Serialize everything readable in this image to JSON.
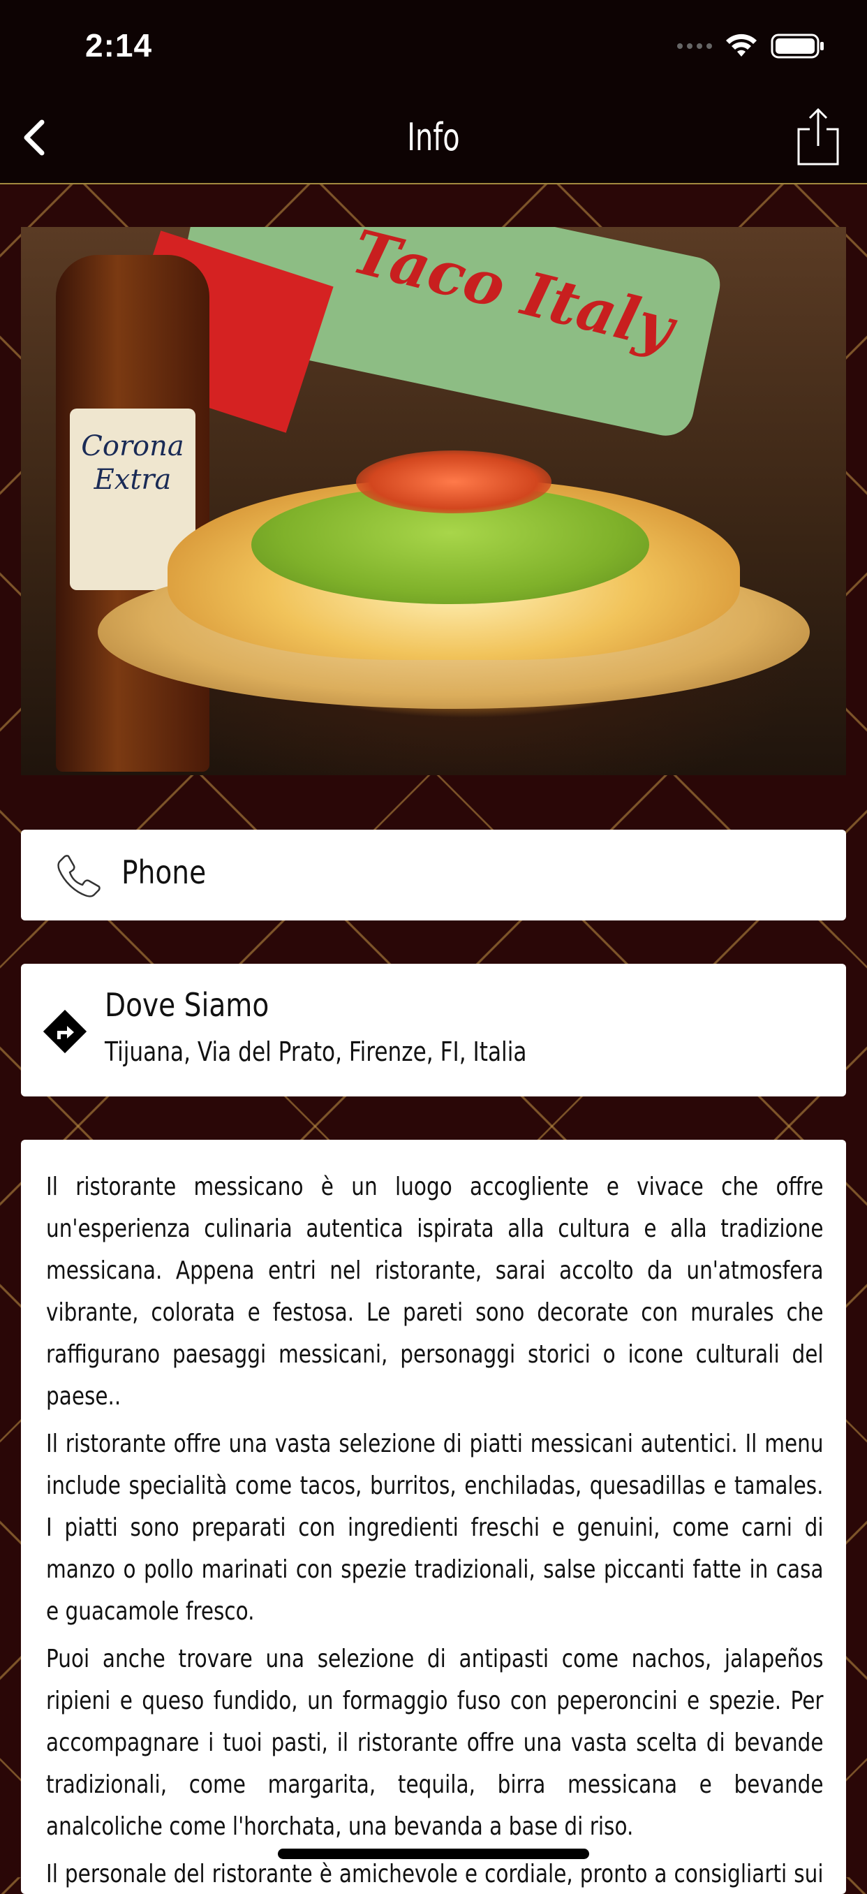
{
  "status_bar": {
    "time": "2:14"
  },
  "nav": {
    "title": "Info"
  },
  "hero": {
    "sign_text": "Taco Italy",
    "bottle_label": "Corona Extra"
  },
  "phone_card": {
    "label": "Phone"
  },
  "address_card": {
    "title": "Dove Siamo",
    "address": "Tijuana, Via del Prato, Firenze, FI, Italia"
  },
  "description": {
    "paragraphs": [
      "Il ristorante messicano è un luogo accogliente e vivace che offre un'esperienza culinaria autentica ispirata alla cultura e alla tradizione messicana. Appena entri nel ristorante, sarai accolto da un'atmosfera vibrante, colorata e festosa. Le pareti sono decorate con murales che raffigurano paesaggi messicani, personaggi storici o icone culturali del paese..",
      "Il ristorante offre una vasta selezione di piatti messicani autentici. Il menu include specialità come tacos, burritos, enchiladas, quesadillas e tamales. I piatti sono preparati con ingredienti freschi e genuini, come carni di manzo o pollo marinati con spezie tradizionali, salse piccanti fatte in casa e guacamole fresco.",
      "Puoi anche trovare una selezione di antipasti come nachos, jalapeños ripieni e queso fundido, un formaggio fuso con peperoncini e spezie. Per accompagnare i tuoi pasti, il ristorante offre una vasta scelta di bevande tradizionali, come margarita, tequila, birra messicana e bevande analcoliche come l'horchata, una bevanda a base di riso.",
      "Il personale del ristorante è amichevole e cordiale, pronto a consigliarti sui piatti e a soddisfare le tue esigenze. Puoi aspettarti un servizio attento e veloce."
    ]
  },
  "icons": {
    "back": "chevron-left-icon",
    "share": "share-icon",
    "phone": "phone-icon",
    "directions": "directions-icon",
    "wifi": "wifi-icon",
    "battery": "battery-icon"
  },
  "colors": {
    "nav_background": "#0d0303",
    "page_background": "#2a0707",
    "accent_gold": "#a2893f",
    "card_background": "#ffffff"
  }
}
